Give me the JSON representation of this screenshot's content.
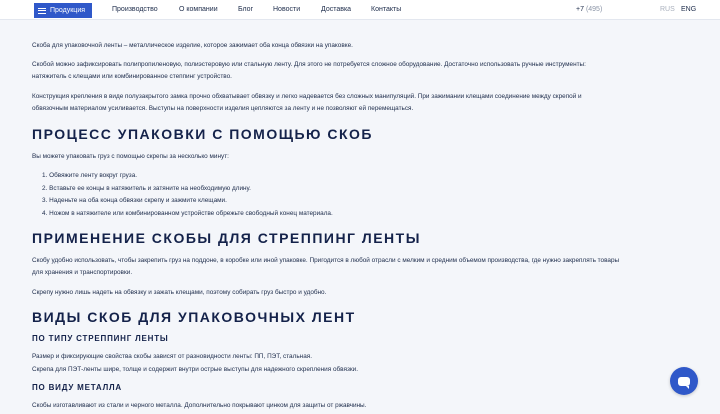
{
  "header": {
    "products_label": "Продукция",
    "nav": [
      "Производство",
      "О компании",
      "Блог",
      "Новости",
      "Доставка",
      "Контакты"
    ],
    "phone_prefix": "+7",
    "phone_code": "(495)",
    "lang_rus": "RUS",
    "lang_eng": "ENG"
  },
  "intro": {
    "p1": "Скоба для упаковочной ленты – металлическое изделие, которое зажимает оба конца обвязки на упаковке.",
    "p2a": "Скобой можно зафиксировать полипропиленовую, полиэстеровую или стальную ленту. Для этого не потребуется сложное оборудование. Достаточно использовать ручные инструменты:",
    "p2b": "натяжитель с клещами или комбинированное степпинг устройство.",
    "p3a": "Конструкция крепления в виде полузакрытого замка прочно обхватывает обвязку и легко надевается без сложных манипуляций. При зажимании клещами соединение между скрепой и",
    "p3b": "обвязочным материалом усиливается. Выступы на поверхности изделия цепляются за ленту и не позволяют ей перемещаться."
  },
  "process": {
    "heading": "Процесс упаковки с помощью скоб",
    "intro": "Вы можете упаковать груз с помощью скрепы за несколько минут:",
    "steps": [
      "Обвяжите ленту вокруг груза.",
      "Вставьте ее концы в натяжитель и затяните на необходимую длину.",
      "Наденьте на оба конца обвязки скрепу и зажмите клещами.",
      "Ножом в натяжителе или комбинированном устройстве обрежьте свободный конец материала."
    ]
  },
  "application": {
    "heading": "Применение скобы для стреппинг ленты",
    "p1a": "Скобу удобно использовать, чтобы закрепить груз на поддоне, в коробке или иной упаковке. Пригодится в любой отрасли с мелким и средним объемом производства, где нужно закреплять товары",
    "p1b": "для хранения и транспортировки.",
    "p2": "Скрепу нужно лишь надеть на обвязку и зажать клещами, поэтому собирать груз быстро и удобно."
  },
  "types": {
    "heading": "Виды скоб для упаковочных лент",
    "by_tape_heading": "По типу стреппинг ленты",
    "by_tape_p1": "Размер и фиксирующие свойства скобы зависят от разновидности ленты: ПП, ПЭТ, стальная.",
    "by_tape_p2": "Скрепа для ПЭТ-ленты шире, толще и содержит внутри острые выступы для надежного скрепления обвязки.",
    "by_metal_heading": "По виду металла",
    "by_metal_p1": "Скобы изготавливают из стали и черного металла. Дополнительно покрывают цинком для защиты от ржавчины."
  },
  "chat": {
    "icon": "chat-icon"
  }
}
